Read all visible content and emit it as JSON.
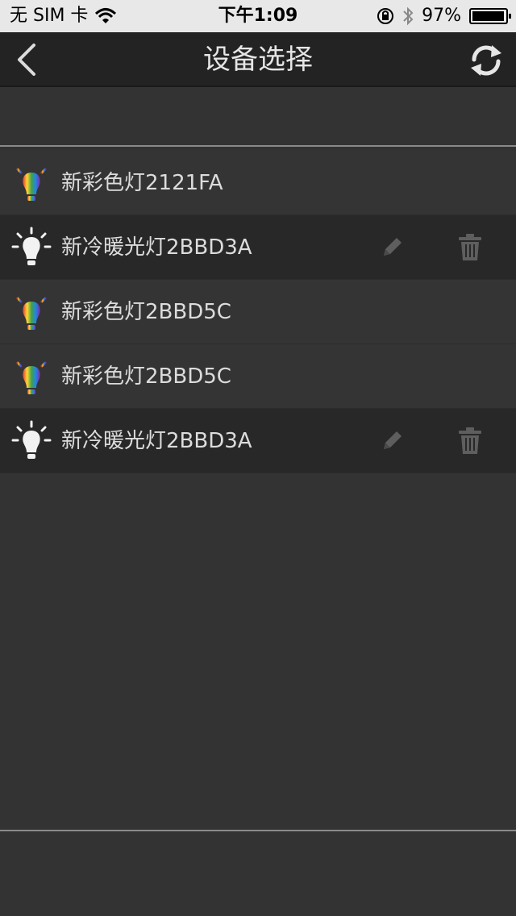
{
  "status_bar": {
    "carrier": "无 SIM 卡",
    "time": "下午1:09",
    "battery": "97%",
    "battery_level": 0.97
  },
  "nav": {
    "title": "设备选择"
  },
  "devices": [
    {
      "label": "新彩色灯2121FA",
      "type": "color",
      "editable": false
    },
    {
      "label": "新冷暖光灯2BBD3A",
      "type": "white",
      "editable": true
    },
    {
      "label": "新彩色灯2BBD5C",
      "type": "color",
      "editable": false
    },
    {
      "label": "新彩色灯2BBD5C",
      "type": "color",
      "editable": false
    },
    {
      "label": "新冷暖光灯2BBD3A",
      "type": "white",
      "editable": true
    }
  ],
  "colors": {
    "background": "#333333",
    "navbar": "#232323",
    "row_dark": "#282828",
    "text": "#dcdcdc"
  }
}
